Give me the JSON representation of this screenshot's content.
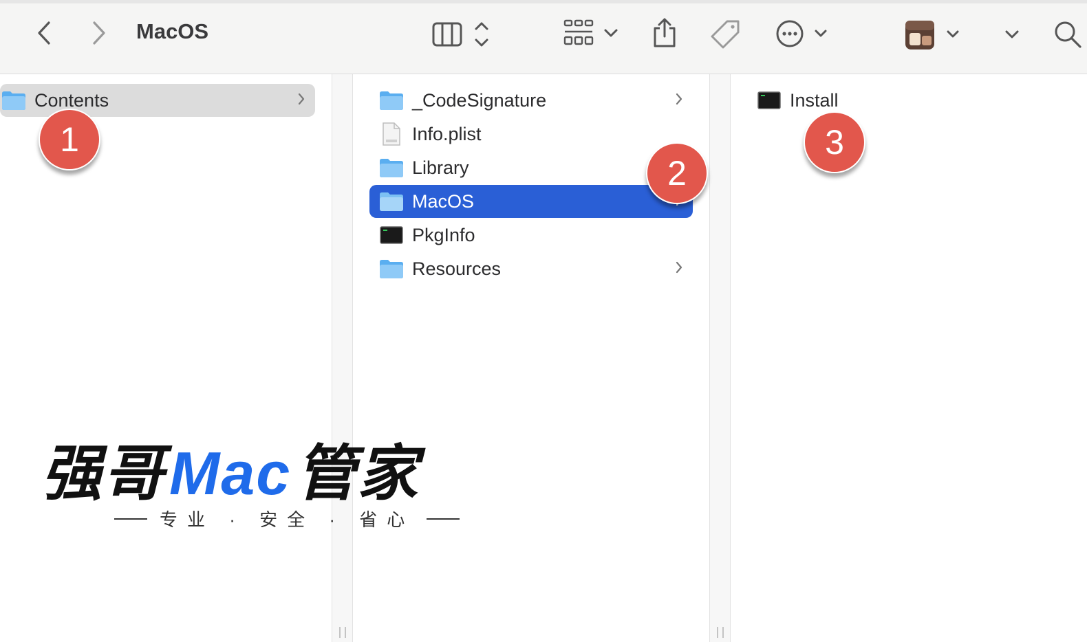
{
  "toolbar": {
    "title": "MacOS",
    "icons": [
      "back-icon",
      "forward-icon",
      "column-view-icon",
      "group-grid-icon",
      "share-icon",
      "tag-icon",
      "more-icon",
      "app-thumbnail-icon",
      "search-icon"
    ]
  },
  "columns": {
    "col1": {
      "items": [
        {
          "name": "Contents",
          "kind": "folder",
          "has_children": true,
          "selected": "grey"
        }
      ]
    },
    "col2": {
      "items": [
        {
          "name": "_CodeSignature",
          "kind": "folder",
          "has_children": true
        },
        {
          "name": "Info.plist",
          "kind": "plist",
          "has_children": false
        },
        {
          "name": "Library",
          "kind": "folder",
          "has_children": false
        },
        {
          "name": "MacOS",
          "kind": "folder",
          "has_children": true,
          "selected": "blue"
        },
        {
          "name": "PkgInfo",
          "kind": "exec",
          "has_children": false
        },
        {
          "name": "Resources",
          "kind": "folder",
          "has_children": true
        }
      ]
    },
    "col3": {
      "items": [
        {
          "name": "Install",
          "kind": "exec",
          "has_children": false
        }
      ]
    }
  },
  "badges": {
    "one": "1",
    "two": "2",
    "three": "3"
  },
  "watermark": {
    "cn_left": "强哥",
    "mac": "Mac",
    "cn_right": "管家",
    "slogan": "专业 · 安全 · 省心"
  },
  "colors": {
    "selection_blue": "#2a5fd6",
    "badge_red": "#e2574c",
    "folder_blue": "#5aaef0",
    "brand_blue": "#1f6bea"
  }
}
